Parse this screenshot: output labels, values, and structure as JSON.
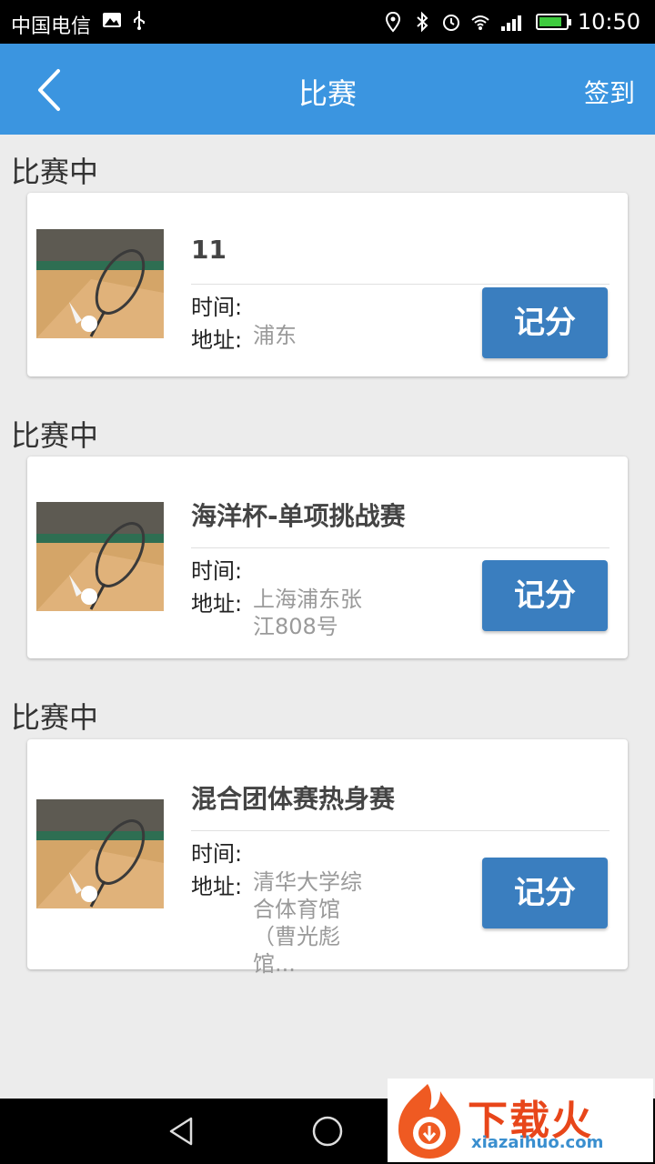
{
  "status_bar": {
    "carrier": "中国电信",
    "time": "10:50",
    "battery_level": 0.85,
    "icons": [
      "photo-icon",
      "usb-icon",
      "location-icon",
      "bluetooth-icon",
      "alarm-icon",
      "wifi-icon",
      "signal-icon",
      "battery-icon"
    ]
  },
  "header": {
    "title": "比赛",
    "checkin_label": "签到",
    "background_color": "#3b95e0"
  },
  "matches": [
    {
      "status": "比赛中",
      "name": "11",
      "time_label": "时间:",
      "time_value": "",
      "address_label": "地址:",
      "address_lines": [
        "浦东"
      ],
      "score_label": "记分"
    },
    {
      "status": "比赛中",
      "name": "海洋杯-单项挑战赛",
      "time_label": "时间:",
      "time_value": "",
      "address_label": "地址:",
      "address_lines": [
        "上海浦东张",
        "江808号"
      ],
      "score_label": "记分"
    },
    {
      "status": "比赛中",
      "name": "混合团体赛热身赛",
      "time_label": "时间:",
      "time_value": "",
      "address_label": "地址:",
      "address_lines": [
        "清华大学综",
        "合体育馆",
        "（曹光彪馆..."
      ],
      "score_label": "记分"
    }
  ],
  "button_color": "#3a7ebf",
  "watermark": {
    "text": "下载火",
    "url": "xiazaihuo.com"
  }
}
